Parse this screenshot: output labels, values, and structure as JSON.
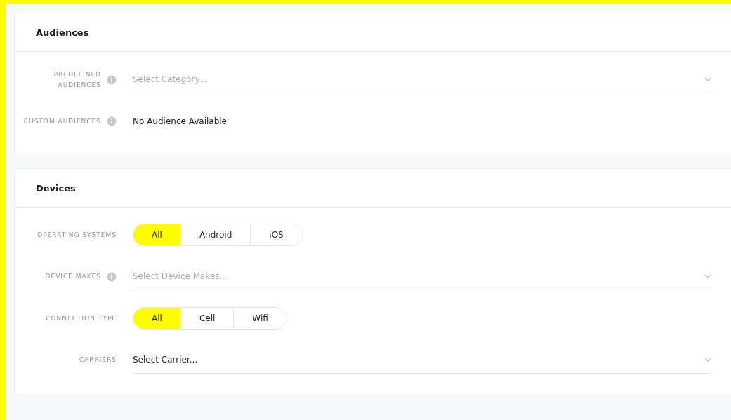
{
  "sections": [
    {
      "title": "Audiences",
      "fields": [
        {
          "kind": "select",
          "label": "PREDEFINED AUDIENCES",
          "info": true,
          "placeholder": "Select Category..."
        },
        {
          "kind": "text",
          "label": "CUSTOM AUDIENCES",
          "info": true,
          "value": "No Audience Available"
        }
      ]
    },
    {
      "title": "Devices",
      "fields": [
        {
          "kind": "segmented",
          "label": "OPERATING SYSTEMS",
          "info": false,
          "options": [
            {
              "label": "All",
              "selected": true
            },
            {
              "label": "Android",
              "selected": false
            },
            {
              "label": "iOS",
              "selected": false
            }
          ]
        },
        {
          "kind": "select",
          "label": "DEVICE MAKES",
          "info": true,
          "placeholder": "Select Device Makes..."
        },
        {
          "kind": "segmented",
          "label": "CONNECTION TYPE",
          "info": false,
          "options": [
            {
              "label": "All",
              "selected": true
            },
            {
              "label": "Cell",
              "selected": false
            },
            {
              "label": "Wifi",
              "selected": false
            }
          ]
        },
        {
          "kind": "select",
          "label": "CARRIERS",
          "info": false,
          "value": "Select Carrier..."
        }
      ]
    }
  ]
}
